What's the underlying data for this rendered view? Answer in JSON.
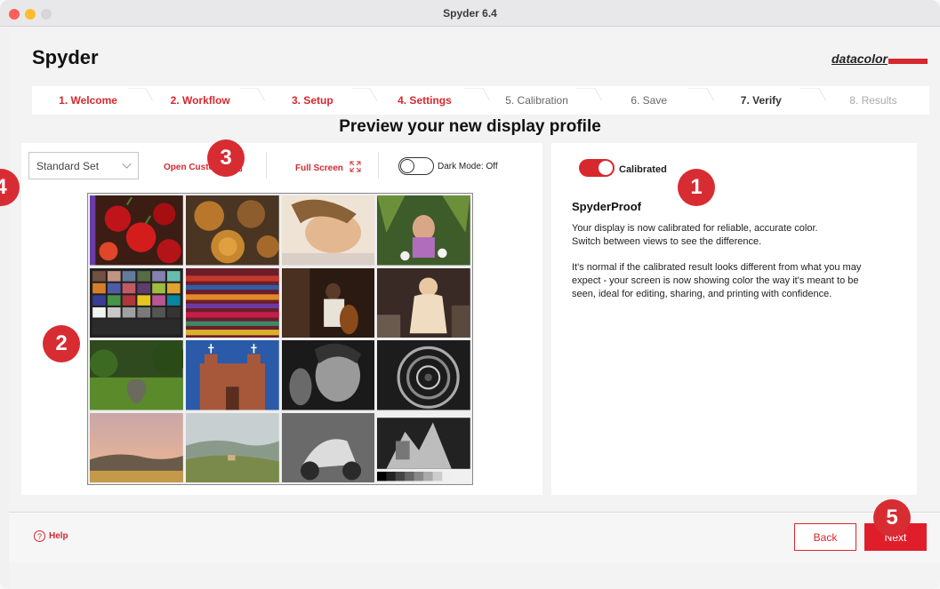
{
  "window": {
    "title": "Spyder 6.4"
  },
  "app": {
    "title": "Spyder",
    "brand": "datacolor"
  },
  "steps": [
    {
      "label": "1. Welcome",
      "state": "done"
    },
    {
      "label": "2. Workflow",
      "state": "done"
    },
    {
      "label": "3. Setup",
      "state": "done"
    },
    {
      "label": "4. Settings",
      "state": "done"
    },
    {
      "label": "5. Calibration",
      "state": "pending"
    },
    {
      "label": "6. Save",
      "state": "pending"
    },
    {
      "label": "7. Verify",
      "state": "current"
    },
    {
      "label": "8. Results",
      "state": "upcoming"
    }
  ],
  "page": {
    "heading": "Preview your new display profile"
  },
  "toolbar": {
    "image_set": "Standard Set",
    "open_custom": "Open Custom",
    "full_screen": "Full Screen",
    "dark_mode_label": "Dark Mode: Off",
    "dark_mode_on": false
  },
  "gallery": {
    "images": [
      "peppers",
      "bowls",
      "woman-portrait",
      "girl-flowers",
      "color-checker",
      "fabric",
      "cellist",
      "dancer",
      "garden-urn",
      "adobe-church",
      "bw-portrait",
      "spiral-stairs",
      "sunset-hills",
      "tuscany-landscape",
      "bw-scooter",
      "bw-test-chart"
    ]
  },
  "preview": {
    "calibrated_label": "Calibrated",
    "calibrated_on": true,
    "title": "SpyderProof",
    "paragraph1_line1": "Your display is now calibrated for reliable, accurate color.",
    "paragraph1_line2": "Switch between views to see the difference.",
    "paragraph2_line1": "It's normal if the calibrated result looks different from what you may",
    "paragraph2_line2": "expect - your screen is now showing color the way it's meant to be",
    "paragraph2_line3": "seen, ideal for editing, sharing, and printing with confidence."
  },
  "footer": {
    "help": "Help",
    "back": "Back",
    "next": "Next"
  },
  "callouts": [
    "1",
    "2",
    "3",
    "4",
    "5"
  ],
  "colors": {
    "accent": "#d7282f",
    "badge": "#d82c33",
    "next_button": "#e01e2b"
  }
}
